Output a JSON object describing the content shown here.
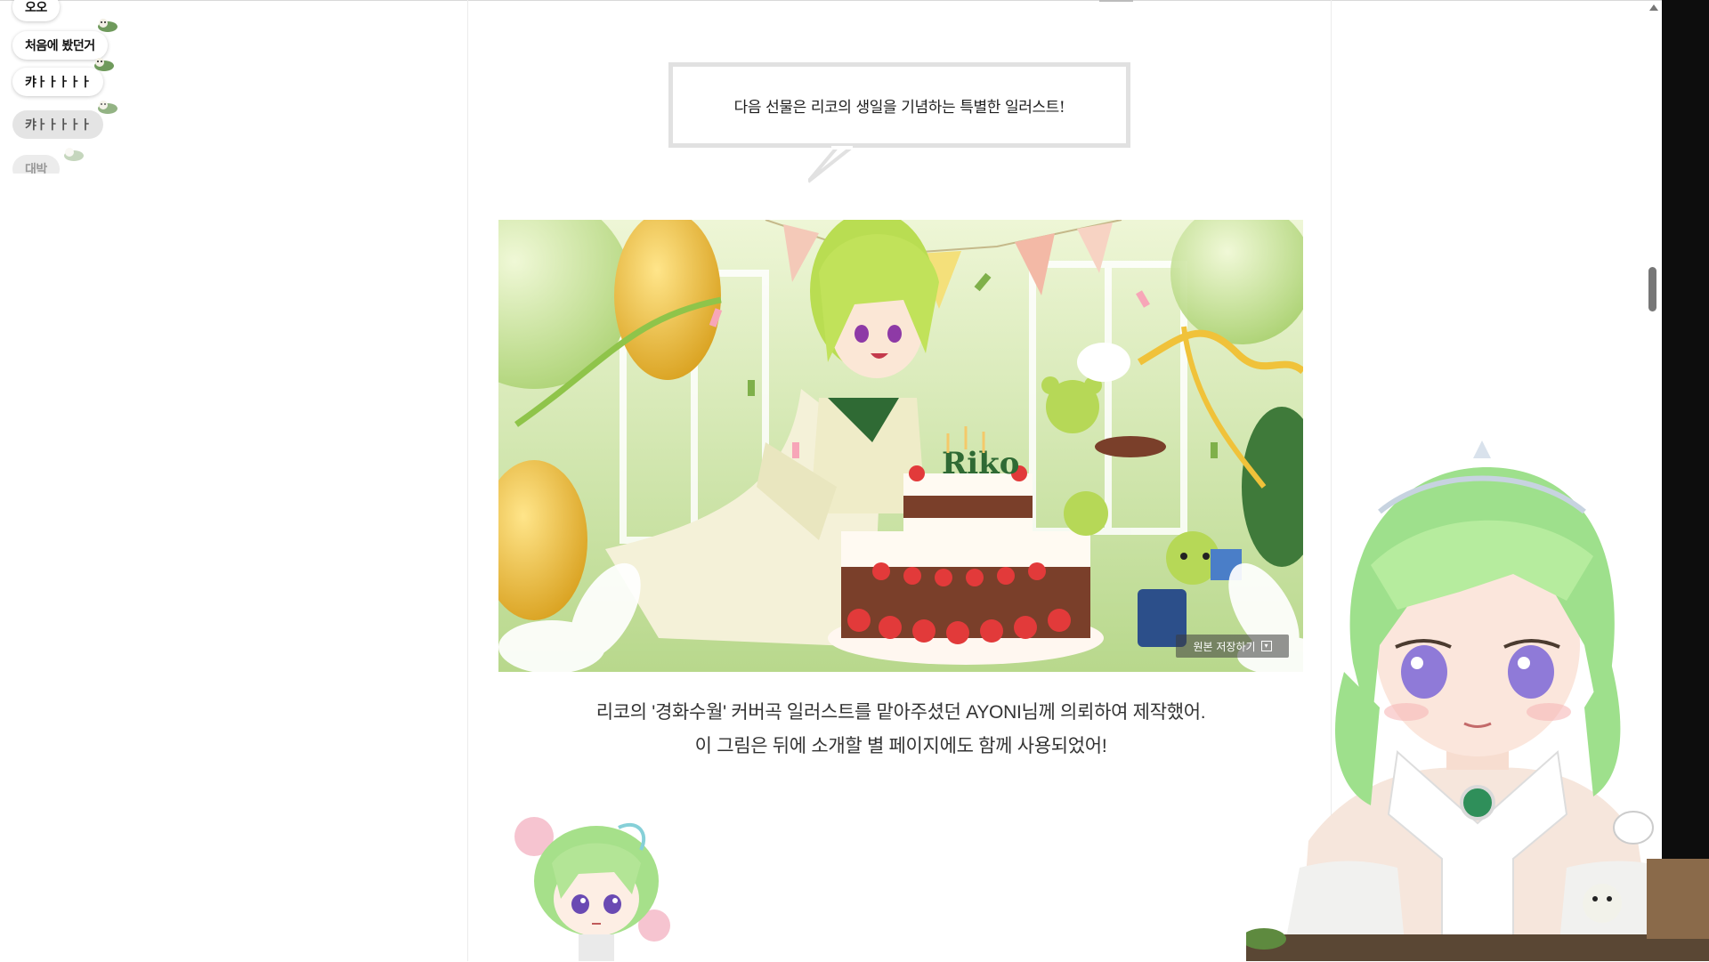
{
  "chat": {
    "messages": [
      {
        "text": "오오"
      },
      {
        "text": "처음에 봤던거"
      },
      {
        "text": "캬ㅏㅏㅏㅏㅏ"
      },
      {
        "text": "캬ㅏㅏㅏㅏㅏ"
      },
      {
        "text": "대박"
      }
    ]
  },
  "article": {
    "speech_text": "다음 선물은 리코의 생일을 기념하는 특별한 일러스트!",
    "illustration": {
      "sign_text": "Riko",
      "save_button_label": "원본 저장하기"
    },
    "caption_line1": "리코의 '경화수월' 커버곡 일러스트를 맡아주셨던 AYONI님께 의뢰하여 제작했어.",
    "caption_line2": "이 그림은 뒤에 소개할 별 페이지에도 함께 사용되었어!"
  },
  "colors": {
    "accent_green": "#a9d86a",
    "hair_green": "#9ee08c",
    "speech_border": "#e1e1e1",
    "background": "#ffffff"
  },
  "icons": [
    "mini-bear-icon",
    "download-icon",
    "scroll-up-icon"
  ]
}
